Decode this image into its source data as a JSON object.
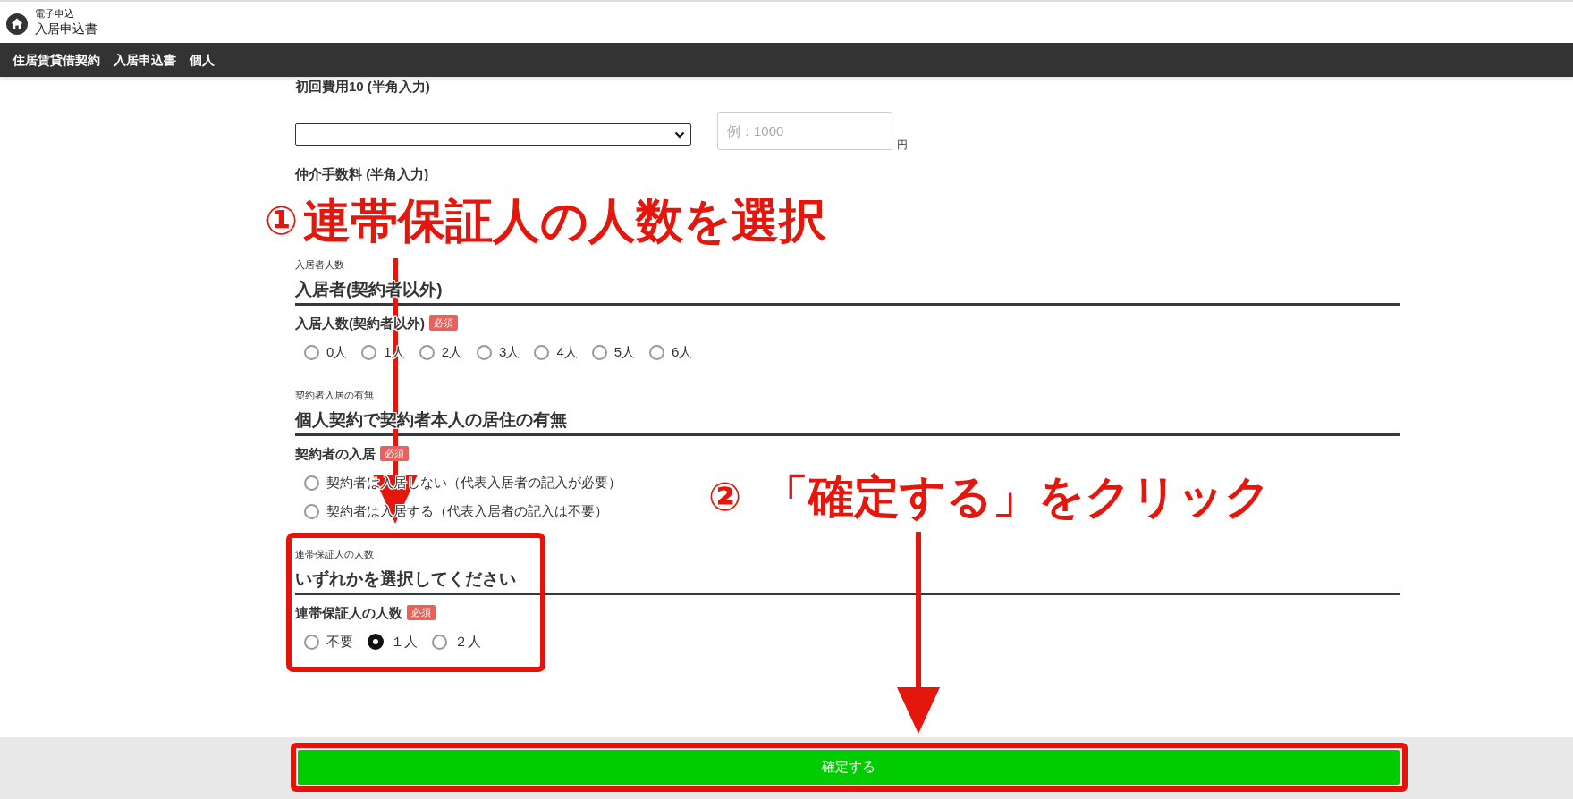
{
  "header": {
    "service": "電子申込",
    "title": "入居申込書"
  },
  "nav": [
    "住居賃貸借契約",
    "入居申込書",
    "個人"
  ],
  "fee_fields": [
    {
      "kind": "select_amount",
      "label": "初回費用10 (半角入力)",
      "placeholder": "例：1000",
      "unit": "円"
    },
    {
      "kind": "covered",
      "label": "仲介手数料 (半角入力)"
    }
  ],
  "sections": [
    {
      "caption": "入居者人数",
      "heading": "入居者(契約者以外)",
      "question": "入居人数(契約者以外)",
      "badge": "必須",
      "kind": "inline",
      "options": [
        {
          "label": "0人",
          "selected": false
        },
        {
          "label": "1人",
          "selected": false
        },
        {
          "label": "2人",
          "selected": false
        },
        {
          "label": "3人",
          "selected": false
        },
        {
          "label": "4人",
          "selected": false
        },
        {
          "label": "5人",
          "selected": false
        },
        {
          "label": "6人",
          "selected": false
        }
      ]
    },
    {
      "caption": "契約者入居の有無",
      "heading": "個人契約で契約者本人の居住の有無",
      "question": "契約者の入居",
      "badge": "必須",
      "kind": "stacked",
      "options": [
        {
          "label": "契約者は入居しない（代表入居者の記入が必要）",
          "selected": false
        },
        {
          "label": "契約者は入居する（代表入居者の記入は不要）",
          "selected": false
        }
      ]
    },
    {
      "caption": "連帯保証人の人数",
      "heading": "いずれかを選択してください",
      "question": "連帯保証人の人数",
      "badge": "必須",
      "kind": "inline",
      "options": [
        {
          "label": "不要",
          "selected": false
        },
        {
          "label": "１人",
          "selected": true
        },
        {
          "label": "２人",
          "selected": false
        }
      ]
    }
  ],
  "submit": {
    "label": "確定する"
  },
  "callouts": [
    {
      "number": "①",
      "text": "連帯保証人の人数を選択"
    },
    {
      "number": "②",
      "text": "「確定する」をクリック"
    }
  ]
}
